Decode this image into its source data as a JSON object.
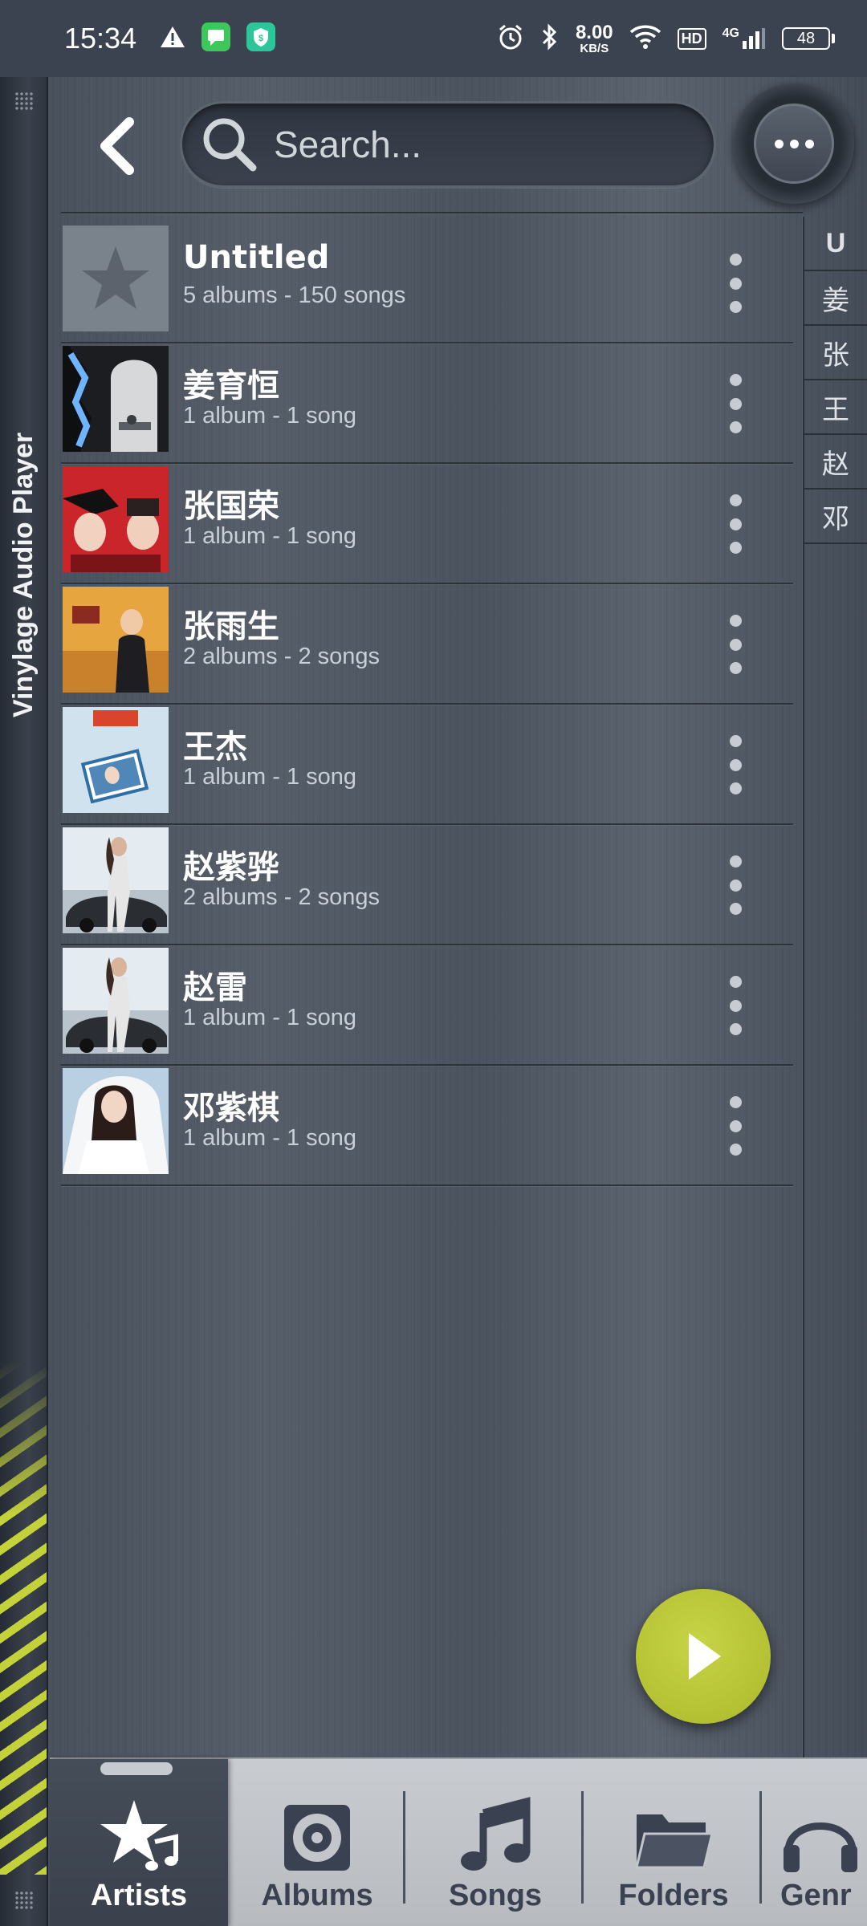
{
  "status_bar": {
    "time": "15:34",
    "net_speed_value": "8.00",
    "net_speed_unit": "KB/S",
    "hd": "HD",
    "network": "4G",
    "battery": "48"
  },
  "app": {
    "title": "Vinylage Audio Player"
  },
  "header": {
    "search_placeholder": "Search..."
  },
  "artists": [
    {
      "name": "Untitled",
      "details": "5 albums - 150 songs"
    },
    {
      "name": "姜育恒",
      "details": "1 album - 1 song"
    },
    {
      "name": "张国荣",
      "details": "1 album - 1 song"
    },
    {
      "name": "张雨生",
      "details": "2 albums - 2 songs"
    },
    {
      "name": "王杰",
      "details": "1 album - 1 song"
    },
    {
      "name": "赵紫骅",
      "details": "2 albums - 2 songs"
    },
    {
      "name": "赵雷",
      "details": "1 album - 1 song"
    },
    {
      "name": "邓紫棋",
      "details": "1 album - 1 song"
    }
  ],
  "index_letters": [
    "U",
    "姜",
    "张",
    "王",
    "赵",
    "邓"
  ],
  "tabs": [
    {
      "label": "Artists",
      "icon": "artist-star-music-icon",
      "active": true
    },
    {
      "label": "Albums",
      "icon": "vinyl-disc-icon",
      "active": false
    },
    {
      "label": "Songs",
      "icon": "music-note-icon",
      "active": false
    },
    {
      "label": "Folders",
      "icon": "folder-icon",
      "active": false
    },
    {
      "label": "Genr",
      "icon": "headphones-icon",
      "active": false
    }
  ],
  "colors": {
    "accent": "#b4c132",
    "background": "#4a525e"
  }
}
